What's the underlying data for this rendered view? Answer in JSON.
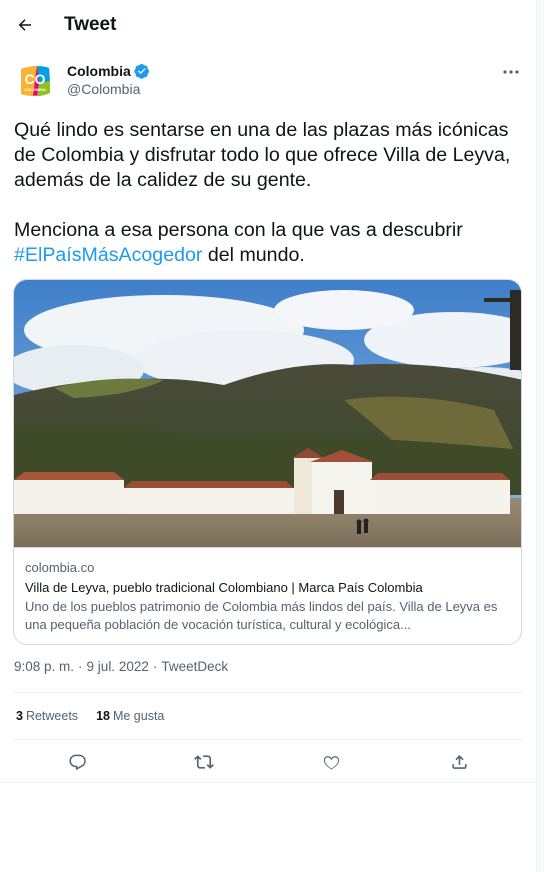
{
  "header": {
    "title": "Tweet"
  },
  "author": {
    "name": "Colombia",
    "handle": "@Colombia",
    "avatar_text": "CO",
    "avatar_subtext": "COLOMBIA",
    "verified": true
  },
  "tweet": {
    "paragraph1": "Qué lindo es sentarse en una de las plazas más icónicas de Colombia y disfrutar todo lo que ofrece Villa de Leyva, además de la calidez de su gente.",
    "paragraph2_prefix": "Menciona a esa persona con la que vas a descubrir ",
    "hashtag": "#ElPaísMásAcogedor",
    "paragraph2_suffix": " del mundo."
  },
  "card": {
    "domain": "colombia.co",
    "title": "Villa de Leyva, pueblo tradicional Colombiano | Marca País Colombia",
    "description": "Uno de los pueblos patrimonio de Colombia más lindos del país. Villa de Leyva es una pequeña población de vocación turística, cultural y ecológica..."
  },
  "meta": {
    "time": "9:08 p. m.",
    "separator": "·",
    "date": "9 jul. 2022",
    "source": "TweetDeck"
  },
  "stats": {
    "retweets_count": "3",
    "retweets_label": "Retweets",
    "likes_count": "18",
    "likes_label": "Me gusta"
  },
  "icons": {
    "back": "arrow-left-icon",
    "more": "more-dots-icon",
    "reply": "reply-icon",
    "retweet": "retweet-icon",
    "like": "heart-icon",
    "share": "share-icon",
    "verified": "verified-badge-icon"
  },
  "colors": {
    "accent": "#1d9bf0",
    "text": "#0f1419",
    "secondary": "#536471",
    "border": "#cfd9de"
  }
}
